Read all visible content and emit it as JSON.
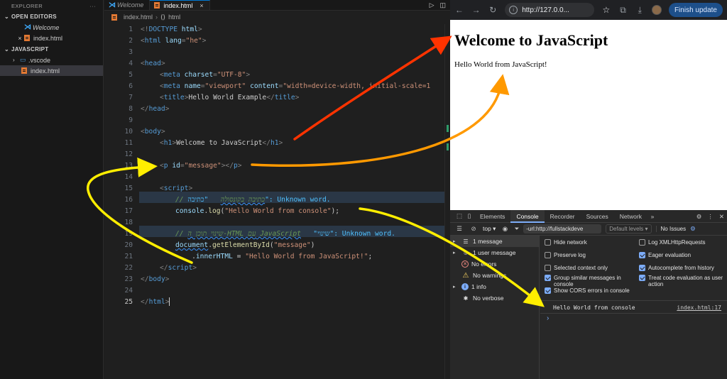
{
  "sidebar": {
    "title": "EXPLORER",
    "menu": "···",
    "open_editors": "OPEN EDITORS",
    "open_items": [
      {
        "label": "Welcome"
      },
      {
        "label": "index.html"
      }
    ],
    "folder": "JAVASCRIPT",
    "tree": [
      {
        "label": ".vscode"
      },
      {
        "label": "index.html"
      }
    ]
  },
  "tabs": [
    {
      "label": "Welcome"
    },
    {
      "label": "index.html",
      "close": "×"
    }
  ],
  "breadcrumb": {
    "file": "index.html",
    "node": "html"
  },
  "code": {
    "l1": [
      "<!",
      "DOCTYPE",
      " html",
      ">"
    ],
    "l2": [
      "<",
      "html",
      " lang",
      "=",
      "\"he\"",
      ">"
    ],
    "l4": [
      "<",
      "head",
      ">"
    ],
    "l5": [
      "<",
      "meta",
      " charset",
      "=",
      "\"UTF-8\"",
      ">"
    ],
    "l6": [
      "<",
      "meta",
      " name",
      "=",
      "\"viewport\"",
      " content",
      "=",
      "\"width=device-width, initial-scale=1"
    ],
    "l7": [
      "<",
      "title",
      ">",
      "Hello World Example",
      "</",
      "title",
      ">"
    ],
    "l8": [
      "</",
      "head",
      ">"
    ],
    "l10": [
      "<",
      "body",
      ">"
    ],
    "l11": [
      "<",
      "h1",
      ">",
      "Welcome to JavaScript",
      "</",
      "h1",
      ">"
    ],
    "l13": [
      "<",
      "p",
      " id",
      "=",
      "\"message\"",
      "></",
      "p",
      ">"
    ],
    "l15": [
      "<",
      "script",
      ">"
    ],
    "l16": [
      "// ",
      "כתיבה בקונסולה",
      "   \"כתיבה\": Unknown word."
    ],
    "l17": [
      "console",
      ".",
      "log",
      "(",
      "\"Hello World from console\"",
      ");"
    ],
    "l19": [
      "// ",
      "שינוי תוכן ה-HTML עם JavaScript",
      "   \"שינוי\": Unknown word."
    ],
    "l20": [
      "document",
      ".",
      "getElementById",
      "(",
      "\"message\"",
      ")"
    ],
    "l21": [
      "    .",
      "innerHTML",
      " = ",
      "\"Hello World from JavaScript!\"",
      ";"
    ],
    "l22": [
      "</",
      "script",
      ">"
    ],
    "l23": [
      "</",
      "body",
      ">"
    ],
    "l25": [
      "</",
      "html",
      ">"
    ]
  },
  "browser": {
    "url": "http://127.0.0...",
    "finish_update": "Finish update",
    "h1": "Welcome to JavaScript",
    "p": "Hello World from JavaScript!"
  },
  "devtools": {
    "tabs": [
      "Elements",
      "Console",
      "Recorder",
      "Sources",
      "Network"
    ],
    "more": "»",
    "context": "top ▾",
    "filter": "-url:http://fullstackdeve",
    "levels": "Default levels ▾",
    "issues": "No Issues",
    "side": [
      {
        "label": "1 message"
      },
      {
        "label": "1 user message"
      },
      {
        "label": "No errors"
      },
      {
        "label": "No warnings"
      },
      {
        "label": "1 info"
      },
      {
        "label": "No verbose"
      }
    ],
    "options_left": [
      {
        "label": "Hide network",
        "checked": false
      },
      {
        "label": "Preserve log",
        "checked": false
      },
      {
        "label": "Selected context only",
        "checked": false
      },
      {
        "label": "Group similar messages in console",
        "checked": true
      },
      {
        "label": "Show CORS errors in console",
        "checked": true
      }
    ],
    "options_right": [
      {
        "label": "Log XMLHttpRequests",
        "checked": false
      },
      {
        "label": "Eager evaluation",
        "checked": true
      },
      {
        "label": "Autocomplete from history",
        "checked": true
      },
      {
        "label": "Treat code evaluation as user action",
        "checked": true
      }
    ],
    "console_message": "Hello World from console",
    "console_source": "index.html:17",
    "prompt": "›"
  },
  "colors": {
    "arrow_red": "#ff3300",
    "arrow_orange": "#ff9900",
    "arrow_yellow": "#ffee00"
  }
}
